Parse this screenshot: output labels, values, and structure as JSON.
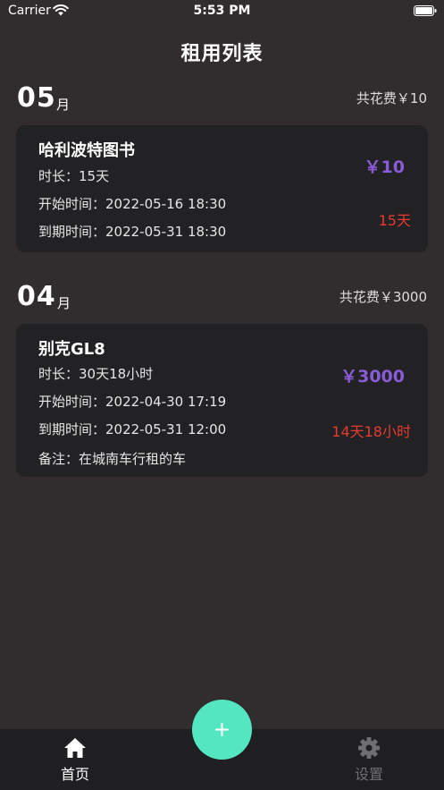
{
  "status_bar": {
    "carrier": "Carrier",
    "time": "5:53 PM"
  },
  "page": {
    "title": "租用列表"
  },
  "months": [
    {
      "number": "05",
      "unit": "月",
      "total": "共花费￥10",
      "rentals": [
        {
          "name": "哈利波特图书",
          "duration": "时长：15天",
          "start": "开始时间：2022-05-16 18:30",
          "end": "到期时间：2022-05-31 18:30",
          "price": "￥10",
          "remaining": "15天"
        }
      ]
    },
    {
      "number": "04",
      "unit": "月",
      "total": "共花费￥3000",
      "rentals": [
        {
          "name": "别克GL8",
          "duration": "时长：30天18小时",
          "start": "开始时间：2022-04-30 17:19",
          "end": "到期时间：2022-05-31 12:00",
          "note": "备注：在城南车行租的车",
          "price": "￥3000",
          "remaining": "14天18小时"
        }
      ]
    }
  ],
  "tab_bar": {
    "home_label": "首页",
    "settings_label": "设置",
    "active": "home",
    "add_icon": "plus-icon"
  },
  "colors": {
    "background": "#312c2d",
    "card": "#222124",
    "price": "#8a5bd7",
    "remaining": "#e53b30",
    "fab": "#54e5c1"
  }
}
